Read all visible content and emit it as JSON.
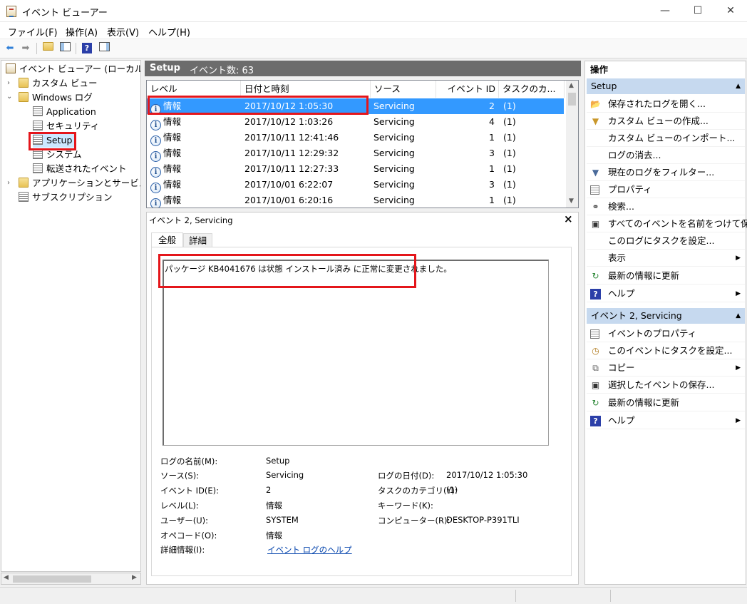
{
  "window": {
    "title": "イベント ビューアー",
    "minimize": "—",
    "maximize": "☐",
    "close": "✕"
  },
  "menu": [
    "ファイル(F)",
    "操作(A)",
    "表示(V)",
    "ヘルプ(H)"
  ],
  "tree": {
    "items": [
      {
        "label": "イベント ビューアー (ローカル)",
        "icon": "event-viewer-icon"
      },
      {
        "label": "カスタム ビュー",
        "icon": "folder-icon"
      },
      {
        "label": "Windows ログ",
        "icon": "folder-icon"
      },
      {
        "label": "Application",
        "icon": "log-icon"
      },
      {
        "label": "セキュリティ",
        "icon": "log-icon"
      },
      {
        "label": "Setup",
        "icon": "log-icon"
      },
      {
        "label": "システム",
        "icon": "log-icon"
      },
      {
        "label": "転送されたイベント",
        "icon": "log-icon"
      },
      {
        "label": "アプリケーションとサービス ログ",
        "icon": "folder-icon"
      },
      {
        "label": "サブスクリプション",
        "icon": "subscription-icon"
      }
    ]
  },
  "center": {
    "log_name": "Setup",
    "event_count": "イベント数: 63"
  },
  "grid": {
    "columns": [
      "レベル",
      "日付と時刻",
      "ソース",
      "イベント ID",
      "タスクのカ..."
    ],
    "rows": [
      {
        "level": "情報",
        "datetime": "2017/10/12 1:05:30",
        "source": "Servicing",
        "id": "2",
        "task": "(1)"
      },
      {
        "level": "情報",
        "datetime": "2017/10/12 1:03:26",
        "source": "Servicing",
        "id": "4",
        "task": "(1)"
      },
      {
        "level": "情報",
        "datetime": "2017/10/11 12:41:46",
        "source": "Servicing",
        "id": "1",
        "task": "(1)"
      },
      {
        "level": "情報",
        "datetime": "2017/10/11 12:29:32",
        "source": "Servicing",
        "id": "3",
        "task": "(1)"
      },
      {
        "level": "情報",
        "datetime": "2017/10/11 12:27:33",
        "source": "Servicing",
        "id": "1",
        "task": "(1)"
      },
      {
        "level": "情報",
        "datetime": "2017/10/01 6:22:07",
        "source": "Servicing",
        "id": "3",
        "task": "(1)"
      },
      {
        "level": "情報",
        "datetime": "2017/10/01 6:20:16",
        "source": "Servicing",
        "id": "1",
        "task": "(1)"
      }
    ]
  },
  "detail": {
    "title": "イベント 2, Servicing",
    "close": "×",
    "tabs": [
      "全般",
      "詳細"
    ],
    "message": "パッケージ KB4041676 は状態 インストール済み に正常に変更されました。",
    "fields": {
      "log_name_label": "ログの名前(M):",
      "log_name": "Setup",
      "source_label": "ソース(S):",
      "source": "Servicing",
      "logged_label": "ログの日付(D):",
      "logged": "2017/10/12 1:05:30",
      "event_id_label": "イベント ID(E):",
      "event_id": "2",
      "task_label": "タスクのカテゴリ(Y):",
      "task": "(1)",
      "level_label": "レベル(L):",
      "level": "情報",
      "keywords_label": "キーワード(K):",
      "user_label": "ユーザー(U):",
      "user": "SYSTEM",
      "computer_label": "コンピューター(R):",
      "computer": "DESKTOP-P391TLI",
      "opcode_label": "オペコード(O):",
      "opcode": "情報",
      "more_info_label": "詳細情報(I):",
      "more_info_link": "イベント ログのヘルプ"
    }
  },
  "actions": {
    "header": "操作",
    "section1": "Setup",
    "section1_items": [
      {
        "label": "保存されたログを開く...",
        "icon": "folder-open-icon"
      },
      {
        "label": "カスタム ビューの作成...",
        "icon": "filter-icon"
      },
      {
        "label": "カスタム ビューのインポート...",
        "icon": ""
      },
      {
        "label": "ログの消去...",
        "icon": ""
      },
      {
        "label": "現在のログをフィルター...",
        "icon": "filter-icon"
      },
      {
        "label": "プロパティ",
        "icon": "properties-icon"
      },
      {
        "label": "検索...",
        "icon": "binoculars-icon"
      },
      {
        "label": "すべてのイベントを名前をつけて保存...",
        "icon": "save-icon"
      },
      {
        "label": "このログにタスクを設定...",
        "icon": ""
      },
      {
        "label": "表示",
        "icon": "",
        "submenu": true
      },
      {
        "label": "最新の情報に更新",
        "icon": "refresh-icon"
      },
      {
        "label": "ヘルプ",
        "icon": "help-icon",
        "submenu": true
      }
    ],
    "section2": "イベント 2, Servicing",
    "section2_items": [
      {
        "label": "イベントのプロパティ",
        "icon": "properties-icon"
      },
      {
        "label": "このイベントにタスクを設定...",
        "icon": "task-icon"
      },
      {
        "label": "コピー",
        "icon": "copy-icon",
        "submenu": true
      },
      {
        "label": "選択したイベントの保存...",
        "icon": "save-icon"
      },
      {
        "label": "最新の情報に更新",
        "icon": "refresh-icon"
      },
      {
        "label": "ヘルプ",
        "icon": "help-icon",
        "submenu": true
      }
    ]
  },
  "colors": {
    "selection": "#3399ff",
    "section_bg": "#c6d9ef",
    "highlight_red": "#e4161b",
    "header_gray": "#6c6c6c"
  }
}
